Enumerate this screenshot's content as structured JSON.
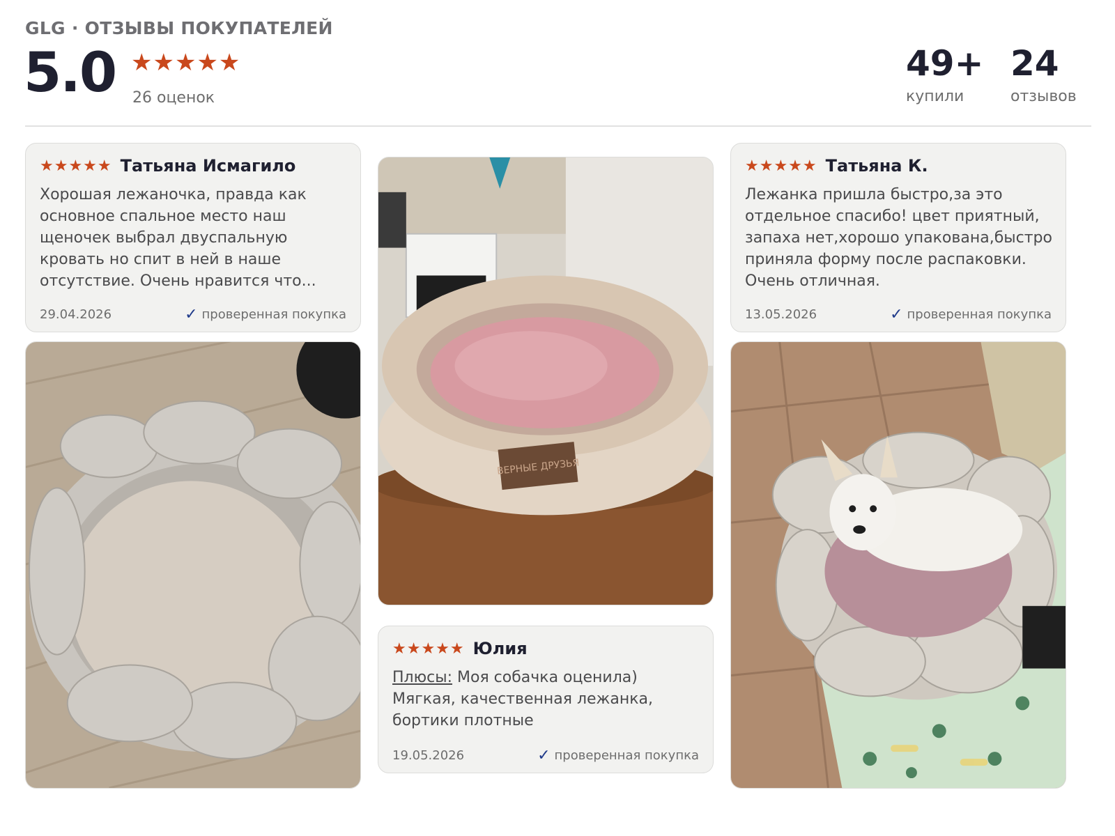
{
  "header": {
    "brand_title": "GLG · ОТЗЫВЫ ПОКУПАТЕЛЕЙ",
    "rating": "5.0",
    "stars": "★★★★★",
    "rating_count": "26 оценок",
    "bought_number": "49+",
    "bought_label": "купили",
    "reviews_number": "24",
    "reviews_label": "отзывов"
  },
  "reviews": [
    {
      "stars": "★★★★★",
      "author": "Татьяна Исмагило",
      "text": "Хорошая лежаночка, правда как основное спальное место наш щеночек выбрал двуспальную кровать   но спит в ней в наше отсутствие. Очень нравится что...",
      "date": "29.04.2026",
      "verified": "проверенная покупка"
    },
    {
      "stars": "★★★★★",
      "author": "Юлия",
      "pros_label": "Плюсы:",
      "text": "Моя собачка оценила) Мягкая, качественная лежанка, бортики плотные",
      "date": "19.05.2026",
      "verified": "проверенная покупка"
    },
    {
      "stars": "★★★★★",
      "author": "Татьяна К.",
      "text": "Лежанка пришла быстро,за это отдельное спасибо! цвет приятный, запаха нет,хорошо упакована,быстро приняла форму после распаковки. Очень отличная.",
      "date": "13.05.2026",
      "verified": "проверенная покупка"
    }
  ],
  "photos": {
    "middle_label": "ВЕРНЫЕ ДРУЗЬЯ"
  },
  "colors": {
    "accent_star": "#c9481c",
    "verified_check": "#1f3a8a",
    "card_bg": "#f2f2f0"
  },
  "icons": {
    "star": "star-icon",
    "check": "check-icon"
  }
}
